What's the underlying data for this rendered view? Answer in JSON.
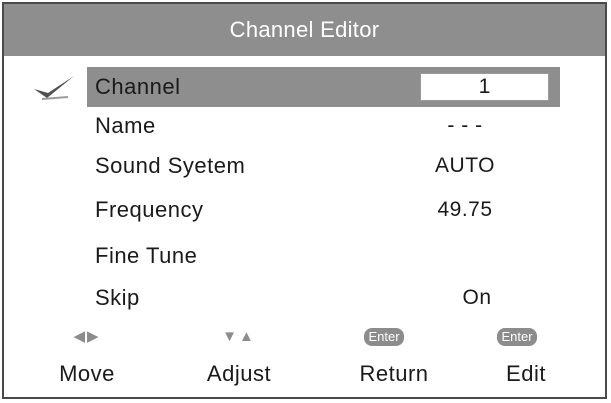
{
  "title": "Channel Editor",
  "items": [
    {
      "label": "Channel",
      "value": "1",
      "selected": true
    },
    {
      "label": "Name",
      "value": "- - -"
    },
    {
      "label": "Sound Syetem",
      "value": "AUTO"
    },
    {
      "label": "Frequency",
      "value": "49.75"
    },
    {
      "label": "Fine Tune",
      "value": ""
    },
    {
      "label": "Skip",
      "value": "On"
    }
  ],
  "hints": [
    {
      "glyph": "◀▶",
      "label": "Move"
    },
    {
      "glyph": "▼▲",
      "label": "Adjust"
    },
    {
      "glyph": "Enter",
      "label": "Return"
    },
    {
      "glyph": "Enter",
      "label": "Edit"
    }
  ],
  "colors": {
    "title_bar": "#8e8e8e",
    "highlight": "#8e8e8e",
    "text": "#1a1a1a",
    "glyph": "#8c8c8c"
  },
  "icons": {
    "selected_marker": "checkmark-icon"
  }
}
